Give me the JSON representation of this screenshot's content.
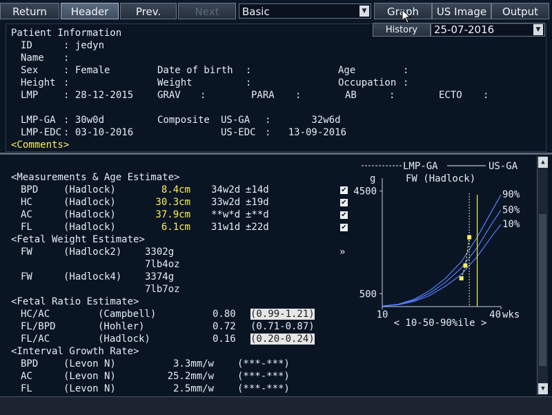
{
  "toolbar": {
    "return_label": "Return",
    "header_label": "Header",
    "prev_label": "Prev.",
    "next_label": "Next",
    "mode_select": "Basic",
    "graph_label": "Graph",
    "usimage_label": "US Image",
    "output_label": "Output",
    "history_label": "History",
    "date_select": "25-07-2016"
  },
  "patient": {
    "section_title": "Patient Information",
    "id_label": "ID",
    "id_value": ": jedyn",
    "name_label": "Name",
    "name_value": ":",
    "sex_label": "Sex",
    "sex_value": ": Female",
    "dob_label": "Date of birth",
    "dob_value": ":",
    "age_label": "Age",
    "age_value": ":",
    "height_label": "Height",
    "height_value": ":",
    "weight_label": "Weight",
    "weight_value": ":",
    "occupation_label": "Occupation",
    "occupation_value": ":",
    "lmp_label": "LMP",
    "lmp_value": ": 28-12-2015",
    "grav_label": "GRAV",
    "grav_value": ":",
    "para_label": "PARA",
    "para_value": ":",
    "ab_label": "AB",
    "ab_value": ":",
    "ecto_label": "ECTO",
    "ecto_value": ":",
    "lmpga_label": "LMP-GA",
    "lmpga_value": ": 30w0d",
    "composite_label": "Composite",
    "usga_label": "US-GA",
    "usga_value": ":       32w6d",
    "lmpedc_label": "LMP-EDC",
    "lmpedc_value": ": 03-10-2016",
    "usedc_label": "US-EDC",
    "usedc_value": ":   13-09-2016",
    "comments_label": "<Comments>"
  },
  "measurements": {
    "title": "<Measurements & Age Estimate>",
    "rows": [
      {
        "name": "BPD",
        "method": "(Hadlock)",
        "value": "8.4cm",
        "ga": "34w2d",
        "sd": "±14d"
      },
      {
        "name": "HC",
        "method": "(Hadlock)",
        "value": "30.3cm",
        "ga": "33w2d",
        "sd": "±19d"
      },
      {
        "name": "AC",
        "method": "(Hadlock)",
        "value": "37.9cm",
        "ga": "**w*d",
        "sd": "±**d"
      },
      {
        "name": "FL",
        "method": "(Hadlock)",
        "value": "6.1cm",
        "ga": "31w1d",
        "sd": "±22d"
      }
    ],
    "check_mark": "✔"
  },
  "fetal_weight": {
    "title": "<Fetal Weight Estimate>",
    "rows": [
      {
        "name": "FW",
        "method": "(Hadlock2)",
        "g": "3302g",
        "lb": "7lb4oz"
      },
      {
        "name": "FW",
        "method": "(Hadlock4)",
        "g": "3374g",
        "lb": "7lb7oz"
      }
    ]
  },
  "ratio": {
    "title": "<Fetal Ratio Estimate>",
    "rows": [
      {
        "name": "HC/AC",
        "method": "(Campbell)",
        "value": "0.80",
        "range": "(0.99-1.21)",
        "out_of_range": true
      },
      {
        "name": "FL/BPD",
        "method": "(Hohler)",
        "value": "0.72",
        "range": "(0.71-0.87)",
        "out_of_range": false
      },
      {
        "name": "FL/AC",
        "method": "(Hadlock)",
        "value": "0.16",
        "range": "(0.20-0.24)",
        "out_of_range": true
      }
    ]
  },
  "growth": {
    "title": "<Interval Growth Rate>",
    "rows": [
      {
        "name": "BPD",
        "method": "(Levon N)",
        "value": "3.3mm/w",
        "range": "(***-***)"
      },
      {
        "name": "AC",
        "method": "(Levon N)",
        "value": "25.2mm/w",
        "range": "(***-***)"
      },
      {
        "name": "FL",
        "method": "(Levon N)",
        "value": "2.5mm/w",
        "range": "(***-***)"
      }
    ]
  },
  "expand_glyph": "»",
  "chart_data": {
    "type": "line",
    "title": "FW (Hadlock)",
    "legend": [
      {
        "name": "LMP-GA",
        "style": "dashed"
      },
      {
        "name": "US-GA",
        "style": "solid"
      }
    ],
    "xlabel": "wks",
    "ylabel": "g",
    "xlim": [
      10,
      40
    ],
    "ylim": [
      0,
      5000
    ],
    "x_ticks": [
      "10",
      "40"
    ],
    "y_ticks": [
      "4500",
      "500"
    ],
    "footer": "< 10-50-90%ile >",
    "percentile_series": [
      {
        "name": "90%",
        "points": [
          [
            10,
            25
          ],
          [
            14,
            90
          ],
          [
            18,
            280
          ],
          [
            22,
            620
          ],
          [
            26,
            1100
          ],
          [
            30,
            1750
          ],
          [
            34,
            2700
          ],
          [
            38,
            3800
          ],
          [
            40,
            4350
          ]
        ]
      },
      {
        "name": "50%",
        "points": [
          [
            10,
            20
          ],
          [
            14,
            80
          ],
          [
            18,
            240
          ],
          [
            22,
            520
          ],
          [
            26,
            950
          ],
          [
            30,
            1500
          ],
          [
            34,
            2300
          ],
          [
            38,
            3300
          ],
          [
            40,
            3750
          ]
        ]
      },
      {
        "name": "10%",
        "points": [
          [
            10,
            15
          ],
          [
            14,
            70
          ],
          [
            18,
            200
          ],
          [
            22,
            430
          ],
          [
            26,
            800
          ],
          [
            30,
            1250
          ],
          [
            34,
            1950
          ],
          [
            38,
            2800
          ],
          [
            40,
            3200
          ]
        ]
      }
    ],
    "measured_points": [
      [
        30,
        1100
      ],
      [
        31,
        1600
      ],
      [
        32,
        2700
      ]
    ],
    "lmp_ga_line_x": 32,
    "us_ga_line_x": 34,
    "colors": {
      "curves": "#5580ff",
      "points": "#ffee55",
      "ga_line": "#ffee55",
      "grid": "#c8d0dc"
    }
  },
  "colors": {
    "background": "#0a1524",
    "highlight": "#ffee55"
  }
}
